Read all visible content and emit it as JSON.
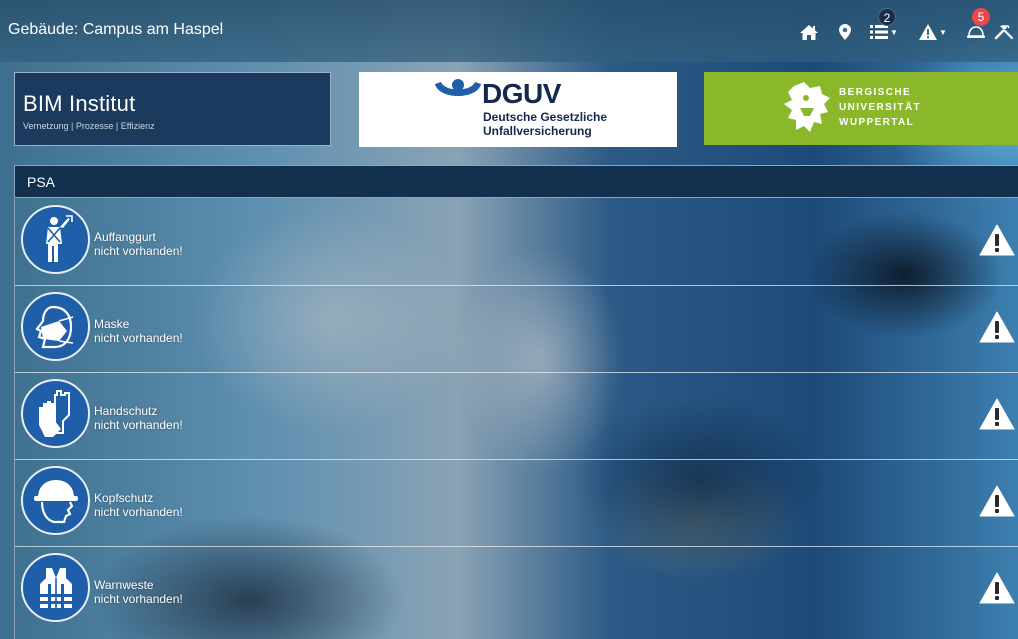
{
  "header": {
    "building_title": "Gebäude: Campus am Haspel",
    "icons": [
      {
        "name": "home-icon"
      },
      {
        "name": "map-marker-icon"
      },
      {
        "name": "list-icon",
        "badge": "2"
      },
      {
        "name": "warning-icon"
      },
      {
        "name": "helmet-icon",
        "badge": "5"
      },
      {
        "name": "tools-icon"
      }
    ]
  },
  "logos": {
    "bim": {
      "title": "BIM Institut",
      "subtitle": "Vernetzung | Prozesse | Effizienz"
    },
    "dguv": {
      "name": "DGUV",
      "line1": "Deutsche Gesetzliche",
      "line2": "Unfallversicherung"
    },
    "buw": {
      "line1": "BERGISCHE",
      "line2": "UNIVERSITÄT",
      "line3": "WUPPERTAL"
    }
  },
  "psa": {
    "title": "PSA",
    "items": [
      {
        "name": "Auffanggurt",
        "status": "nicht vorhanden!",
        "icon": "harness-icon"
      },
      {
        "name": "Maske",
        "status": "nicht vorhanden!",
        "icon": "mask-icon"
      },
      {
        "name": "Handschutz",
        "status": "nicht vorhanden!",
        "icon": "gloves-icon"
      },
      {
        "name": "Kopfschutz",
        "status": "nicht vorhanden!",
        "icon": "hardhat-icon"
      },
      {
        "name": "Warnweste",
        "status": "nicht vorhanden!",
        "icon": "vest-icon"
      }
    ]
  },
  "colors": {
    "topbar": "#3b7193",
    "panel": "#14304f",
    "psa_circle": "#1f5ea8",
    "badge_red": "#e84a4a",
    "buw_green": "#8ab82a",
    "dguv_blue": "#13294b"
  }
}
